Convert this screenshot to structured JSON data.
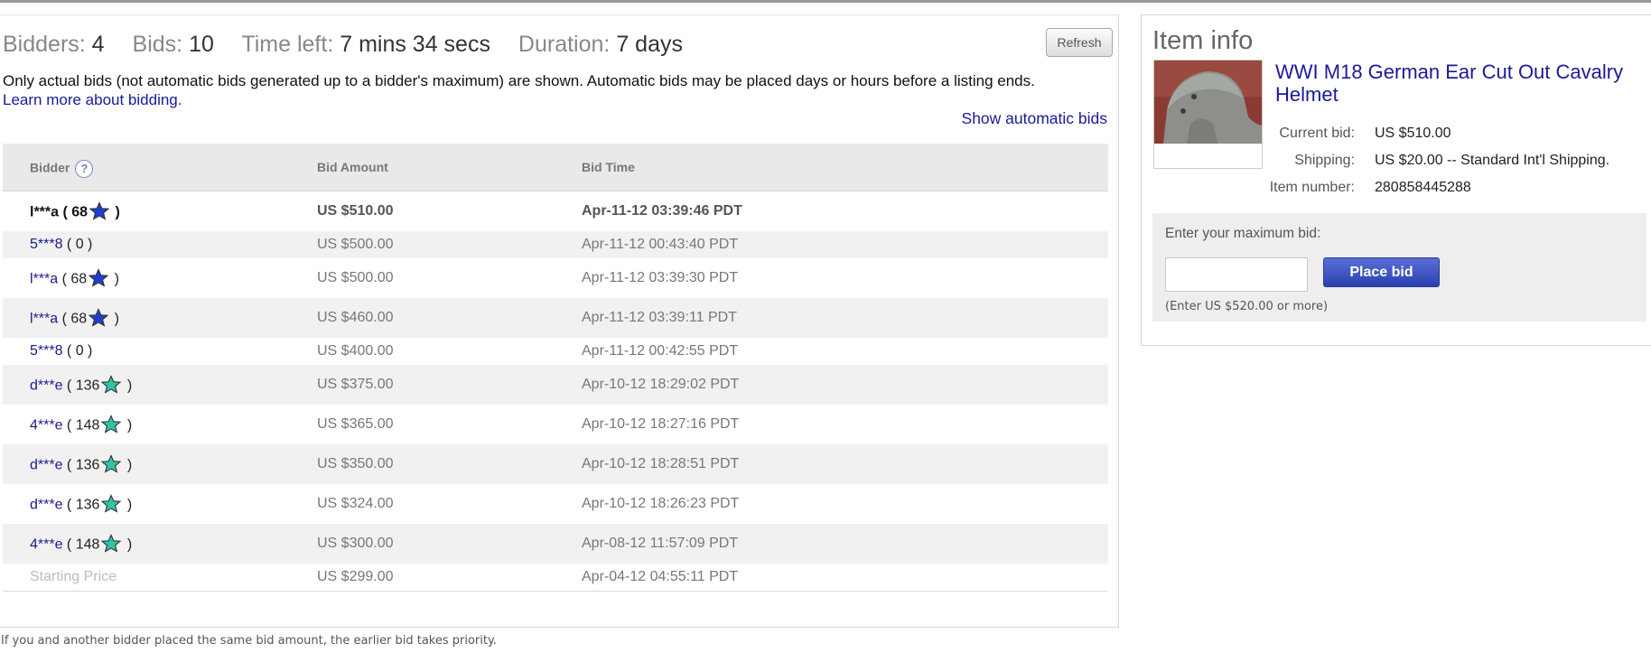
{
  "stats": {
    "bidders_label": "Bidders:",
    "bidders_value": "4",
    "bids_label": "Bids:",
    "bids_value": "10",
    "time_label": "Time left:",
    "time_value": "7 mins 34 secs",
    "duration_label": "Duration:",
    "duration_value": "7 days"
  },
  "refresh_label": "Refresh",
  "notice": "Only actual bids (not automatic bids generated up to a bidder's maximum) are shown. Automatic bids may be placed days or hours before a listing ends.",
  "learn_more": "Learn more about bidding.",
  "show_automatic_bids": "Show automatic bids",
  "table": {
    "headers": {
      "bidder": "Bidder",
      "amount": "Bid Amount",
      "time": "Bid Time"
    },
    "help_glyph": "?",
    "rows": [
      {
        "bidder": "l***a",
        "open": " ( 68",
        "close": " )",
        "star": "blue",
        "amount": "US $510.00",
        "time": "Apr-11-12 03:39:46 PDT"
      },
      {
        "bidder": "5***8",
        "open": " ( 0 )",
        "close": "",
        "star": "",
        "amount": "US $500.00",
        "time": "Apr-11-12 00:43:40 PDT"
      },
      {
        "bidder": "l***a",
        "open": " ( 68",
        "close": " )",
        "star": "blue",
        "amount": "US $500.00",
        "time": "Apr-11-12 03:39:30 PDT"
      },
      {
        "bidder": "l***a",
        "open": " ( 68",
        "close": " )",
        "star": "blue",
        "amount": "US $460.00",
        "time": "Apr-11-12 03:39:11 PDT"
      },
      {
        "bidder": "5***8",
        "open": " ( 0 )",
        "close": "",
        "star": "",
        "amount": "US $400.00",
        "time": "Apr-11-12 00:42:55 PDT"
      },
      {
        "bidder": "d***e",
        "open": " ( 136",
        "close": " )",
        "star": "teal",
        "amount": "US $375.00",
        "time": "Apr-10-12 18:29:02 PDT"
      },
      {
        "bidder": "4***e",
        "open": " ( 148",
        "close": " )",
        "star": "teal",
        "amount": "US $365.00",
        "time": "Apr-10-12 18:27:16 PDT"
      },
      {
        "bidder": "d***e",
        "open": " ( 136",
        "close": " )",
        "star": "teal",
        "amount": "US $350.00",
        "time": "Apr-10-12 18:28:51 PDT"
      },
      {
        "bidder": "d***e",
        "open": " ( 136",
        "close": " )",
        "star": "teal",
        "amount": "US $324.00",
        "time": "Apr-10-12 18:26:23 PDT"
      },
      {
        "bidder": "4***e",
        "open": " ( 148",
        "close": " )",
        "star": "teal",
        "amount": "US $300.00",
        "time": "Apr-08-12 11:57:09 PDT"
      }
    ],
    "starting": {
      "label": "Starting Price",
      "amount": "US $299.00",
      "time": "Apr-04-12 04:55:11 PDT"
    }
  },
  "footnote": "If you and another bidder placed the same bid amount, the earlier bid takes priority.",
  "item_info": {
    "title": "Item info",
    "item_title": "WWI M18 German Ear Cut Out Cavalry Helmet",
    "current_bid_label": "Current bid:",
    "current_bid_value": "US $510.00",
    "shipping_label": "Shipping:",
    "shipping_value": "US $20.00 -- Standard Int'l Shipping.",
    "item_number_label": "Item number:",
    "item_number_value": "280858445288"
  },
  "bid_form": {
    "label": "Enter your maximum bid:",
    "input_value": "",
    "button_label": "Place bid",
    "hint": "(Enter US $520.00 or more)"
  },
  "colors": {
    "star_blue": "#1c3fd1",
    "star_teal": "#2fc4a8",
    "link": "#1a1a9a",
    "button": "#3a50c4"
  }
}
